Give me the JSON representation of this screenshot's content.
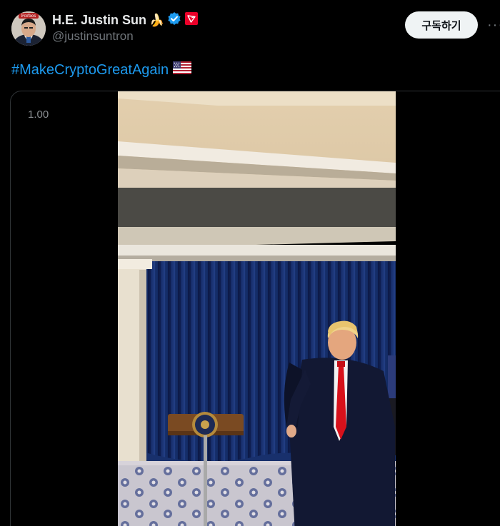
{
  "author": {
    "display_name": "H.E. Justin Sun",
    "handle": "@justinsuntron",
    "name_emoji": "🍌",
    "avatar_badge_text": "Forbes",
    "icons": [
      "verified-badge-icon",
      "tron-affiliate-icon"
    ]
  },
  "actions": {
    "subscribe_label": "구독하기",
    "more_label": "···"
  },
  "tweet": {
    "hashtag": "#MakeCryptoGreatAgain",
    "flag_emoji": "🇺🇸"
  },
  "media": {
    "playback_speed": "1.00"
  },
  "colors": {
    "background": "#000000",
    "link": "#1d9bf0",
    "secondary_text": "#71767b",
    "verified": "#1d9bf0",
    "tron_red": "#eb0029"
  }
}
